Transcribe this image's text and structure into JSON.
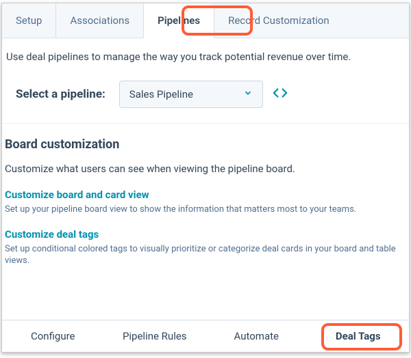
{
  "topTabs": {
    "setup": "Setup",
    "associations": "Associations",
    "pipelines": "Pipelines",
    "recordCustomization": "Record Customization"
  },
  "description": "Use deal pipelines to manage the way you track potential revenue over time.",
  "selectPipeline": {
    "label": "Select a pipeline:",
    "value": "Sales Pipeline"
  },
  "boardCustomization": {
    "heading": "Board customization",
    "subdesc": "Customize what users can see when viewing the pipeline board.",
    "link1": {
      "title": "Customize board and card view",
      "desc": "Set up your pipeline board view to show the information that matters most to your teams."
    },
    "link2": {
      "title": "Customize deal tags",
      "desc": "Set up conditional colored tags to visually prioritize or categorize deal cards in your board and table views."
    }
  },
  "bottomTabs": {
    "configure": "Configure",
    "pipelineRules": "Pipeline Rules",
    "automate": "Automate",
    "dealTags": "Deal Tags"
  }
}
